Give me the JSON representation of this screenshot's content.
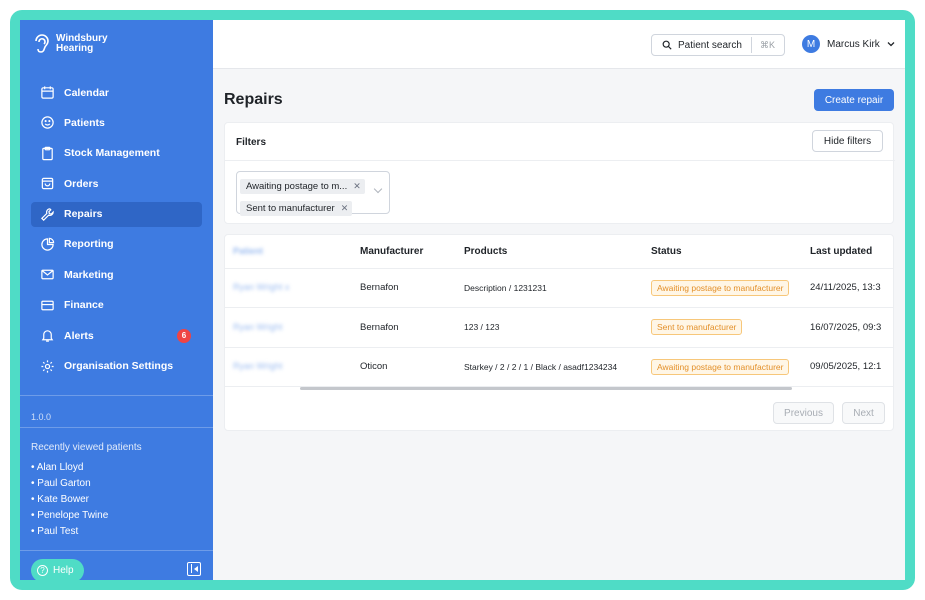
{
  "brand": {
    "name": "Windsbury\nHearing"
  },
  "sidebar": {
    "items": [
      {
        "label": "Calendar",
        "icon": "calendar-icon"
      },
      {
        "label": "Patients",
        "icon": "smiley-icon"
      },
      {
        "label": "Stock Management",
        "icon": "clipboard-icon"
      },
      {
        "label": "Orders",
        "icon": "bag-icon"
      },
      {
        "label": "Repairs",
        "icon": "wrench-icon",
        "active": true
      },
      {
        "label": "Reporting",
        "icon": "pie-chart-icon"
      },
      {
        "label": "Marketing",
        "icon": "mail-icon"
      },
      {
        "label": "Finance",
        "icon": "credit-card-icon"
      },
      {
        "label": "Alerts",
        "icon": "bell-icon",
        "badge": "6"
      },
      {
        "label": "Organisation Settings",
        "icon": "gear-icon"
      }
    ],
    "version": "1.0.0",
    "recent_title": "Recently viewed patients",
    "recent_patients": [
      "• Alan Lloyd",
      "• Paul Garton",
      "• Kate Bower",
      "• Penelope Twine",
      "• Paul Test"
    ],
    "help_label": "Help"
  },
  "topbar": {
    "search_label": "Patient search",
    "search_shortcut": "⌘K",
    "user_initial": "M",
    "user_name": "Marcus Kirk"
  },
  "page": {
    "title": "Repairs",
    "create_label": "Create repair"
  },
  "filters": {
    "title": "Filters",
    "hide_label": "Hide filters",
    "chips": [
      "Awaiting postage to m...",
      "Sent to manufacturer"
    ]
  },
  "table": {
    "columns": [
      "Patient",
      "Manufacturer",
      "Products",
      "Status",
      "Last updated"
    ],
    "rows": [
      {
        "patient": "Ryan Wright x",
        "manufacturer": "Bernafon",
        "products": "Description / 1231231",
        "status": "Awaiting postage to manufacturer",
        "updated": "24/11/2025, 13:3"
      },
      {
        "patient": "Ryan Wright",
        "manufacturer": "Bernafon",
        "products": "123 / 123",
        "status": "Sent to manufacturer",
        "updated": "16/07/2025, 09:3"
      },
      {
        "patient": "Ryan Wright",
        "manufacturer": "Oticon",
        "products": "Starkey / 2 / 2 / 1 / Black / asadf1234234",
        "status": "Awaiting postage to manufacturer",
        "updated": "09/05/2025, 12:1"
      }
    ],
    "prev_label": "Previous",
    "next_label": "Next"
  },
  "colors": {
    "sidebar": "#3e7be1",
    "accent": "#4fdcc6",
    "status_text": "#e3902a"
  }
}
